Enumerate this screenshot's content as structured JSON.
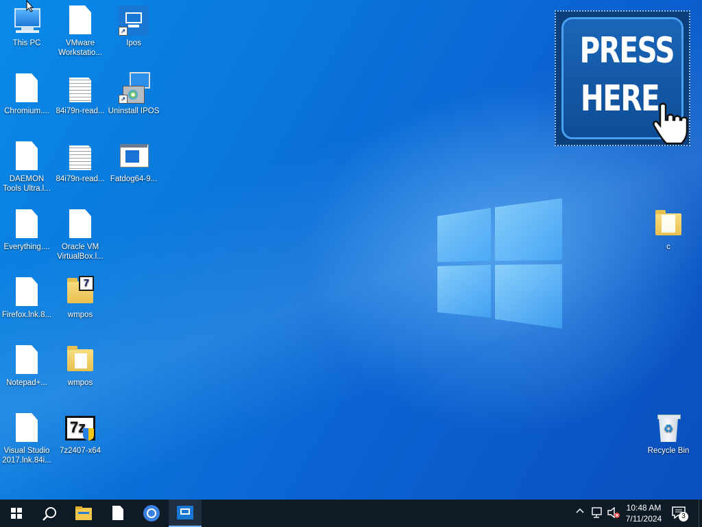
{
  "desktop": {
    "icons": [
      {
        "label": "This PC"
      },
      {
        "label": "VMware Workstatio..."
      },
      {
        "label": "Ipos"
      },
      {
        "label": "Chromium...."
      },
      {
        "label": "84i79n-read..."
      },
      {
        "label": "Uninstall IPOS"
      },
      {
        "label": "DAEMON Tools Ultra.l..."
      },
      {
        "label": "84i79n-read..."
      },
      {
        "label": "Fatdog64-9..."
      },
      {
        "label": "Everything...."
      },
      {
        "label": "Oracle VM VirtualBox.l..."
      },
      {
        "label": "Firefox.lnk.8..."
      },
      {
        "label": "wmpos"
      },
      {
        "label": "Notepad+..."
      },
      {
        "label": "wmpos"
      },
      {
        "label": "Visual Studio 2017.lnk.84i..."
      },
      {
        "label": "7z2407-x64"
      },
      {
        "label": "c"
      },
      {
        "label": "Recycle Bin"
      }
    ]
  },
  "banner": {
    "line1": "PRESS",
    "line2": "HERE"
  },
  "taskbar": {
    "time": "10:48 AM",
    "date": "7/11/2024",
    "notification_count": "3"
  },
  "colors": {
    "taskbar": "#0e1a26",
    "accent": "#0a78dc"
  }
}
